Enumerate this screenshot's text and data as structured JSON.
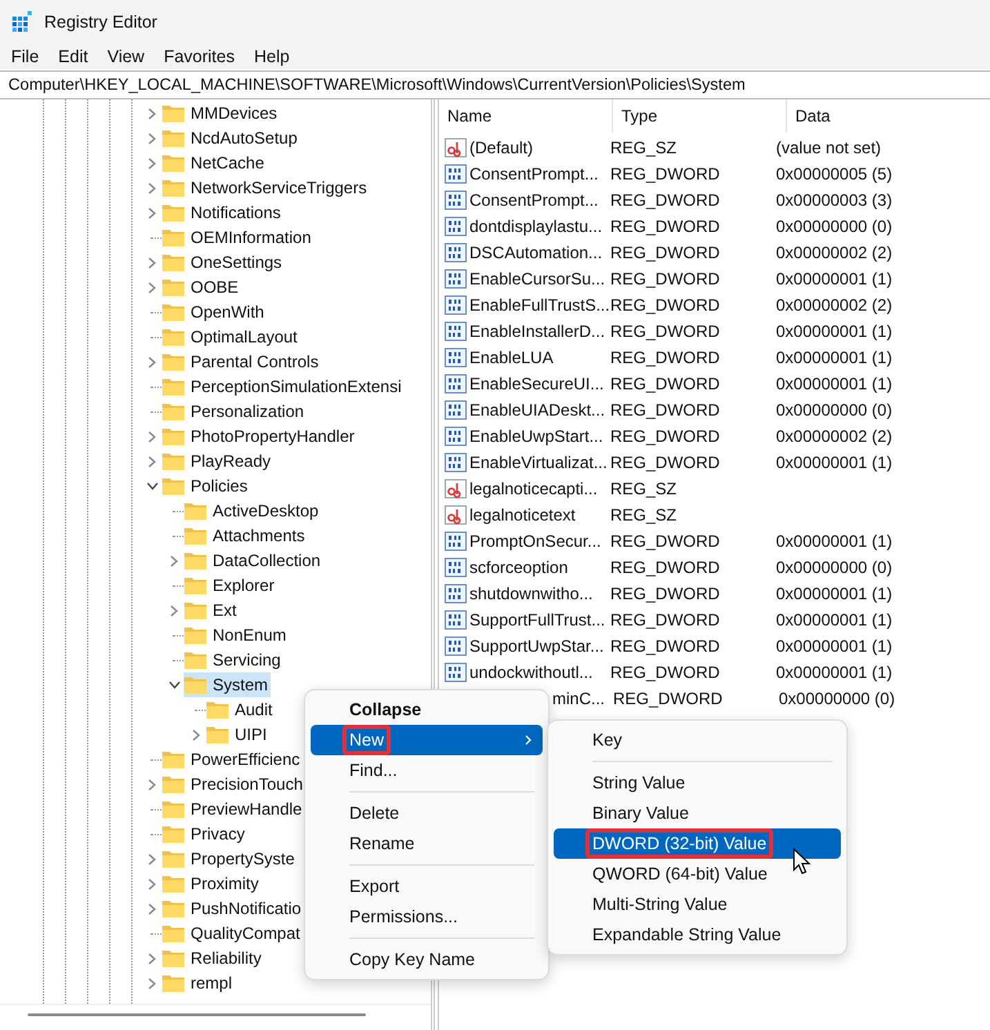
{
  "window": {
    "title": "Registry Editor"
  },
  "menu_bar": [
    "File",
    "Edit",
    "View",
    "Favorites",
    "Help"
  ],
  "address_bar": {
    "value": "Computer\\HKEY_LOCAL_MACHINE\\SOFTWARE\\Microsoft\\Windows\\CurrentVersion\\Policies\\System"
  },
  "tree": [
    {
      "label": "MMDevices",
      "expandable": true,
      "expanded": false,
      "selected": false
    },
    {
      "label": "NcdAutoSetup",
      "expandable": true,
      "expanded": false,
      "selected": false
    },
    {
      "label": "NetCache",
      "expandable": true,
      "expanded": false,
      "selected": false
    },
    {
      "label": "NetworkServiceTriggers",
      "expandable": true,
      "expanded": false,
      "selected": false
    },
    {
      "label": "Notifications",
      "expandable": true,
      "expanded": false,
      "selected": false
    },
    {
      "label": "OEMInformation",
      "expandable": false,
      "selected": false
    },
    {
      "label": "OneSettings",
      "expandable": true,
      "expanded": false,
      "selected": false
    },
    {
      "label": "OOBE",
      "expandable": true,
      "expanded": false,
      "selected": false
    },
    {
      "label": "OpenWith",
      "expandable": false,
      "selected": false
    },
    {
      "label": "OptimalLayout",
      "expandable": false,
      "selected": false
    },
    {
      "label": "Parental Controls",
      "expandable": true,
      "expanded": false,
      "selected": false
    },
    {
      "label": "PerceptionSimulationExtensi",
      "expandable": false,
      "selected": false
    },
    {
      "label": "Personalization",
      "expandable": false,
      "selected": false
    },
    {
      "label": "PhotoPropertyHandler",
      "expandable": true,
      "expanded": false,
      "selected": false
    },
    {
      "label": "PlayReady",
      "expandable": true,
      "expanded": false,
      "selected": false
    },
    {
      "label": "Policies",
      "expandable": true,
      "expanded": true,
      "selected": false,
      "children": [
        {
          "label": "ActiveDesktop",
          "expandable": false,
          "selected": false
        },
        {
          "label": "Attachments",
          "expandable": false,
          "selected": false
        },
        {
          "label": "DataCollection",
          "expandable": true,
          "expanded": false,
          "selected": false
        },
        {
          "label": "Explorer",
          "expandable": false,
          "selected": false
        },
        {
          "label": "Ext",
          "expandable": true,
          "expanded": false,
          "selected": false
        },
        {
          "label": "NonEnum",
          "expandable": false,
          "selected": false
        },
        {
          "label": "Servicing",
          "expandable": false,
          "selected": false
        },
        {
          "label": "System",
          "expandable": true,
          "expanded": true,
          "selected": true,
          "children": [
            {
              "label": "Audit",
              "expandable": false,
              "selected": false
            },
            {
              "label": "UIPI",
              "expandable": true,
              "expanded": false,
              "selected": false
            }
          ]
        }
      ]
    },
    {
      "label": "PowerEfficienc",
      "expandable": false,
      "selected": false
    },
    {
      "label": "PrecisionTouch",
      "expandable": true,
      "expanded": false,
      "selected": false
    },
    {
      "label": "PreviewHandle",
      "expandable": false,
      "selected": false
    },
    {
      "label": "Privacy",
      "expandable": false,
      "selected": false
    },
    {
      "label": "PropertySyste",
      "expandable": true,
      "expanded": false,
      "selected": false
    },
    {
      "label": "Proximity",
      "expandable": true,
      "expanded": false,
      "selected": false
    },
    {
      "label": "PushNotificatio",
      "expandable": true,
      "expanded": false,
      "selected": false
    },
    {
      "label": "QualityCompat",
      "expandable": false,
      "selected": false
    },
    {
      "label": "Reliability",
      "expandable": true,
      "expanded": false,
      "selected": false
    },
    {
      "label": "rempl",
      "expandable": true,
      "expanded": false,
      "selected": false
    }
  ],
  "values": {
    "columns": [
      "Name",
      "Type",
      "Data"
    ],
    "rows": [
      {
        "kind": "string",
        "name": "(Default)",
        "type": "REG_SZ",
        "data": "(value not set)"
      },
      {
        "kind": "dword",
        "name": "ConsentPrompt...",
        "type": "REG_DWORD",
        "data": "0x00000005 (5)"
      },
      {
        "kind": "dword",
        "name": "ConsentPrompt...",
        "type": "REG_DWORD",
        "data": "0x00000003 (3)"
      },
      {
        "kind": "dword",
        "name": "dontdisplaylastu...",
        "type": "REG_DWORD",
        "data": "0x00000000 (0)"
      },
      {
        "kind": "dword",
        "name": "DSCAutomation...",
        "type": "REG_DWORD",
        "data": "0x00000002 (2)"
      },
      {
        "kind": "dword",
        "name": "EnableCursorSu...",
        "type": "REG_DWORD",
        "data": "0x00000001 (1)"
      },
      {
        "kind": "dword",
        "name": "EnableFullTrustS...",
        "type": "REG_DWORD",
        "data": "0x00000002 (2)"
      },
      {
        "kind": "dword",
        "name": "EnableInstallerD...",
        "type": "REG_DWORD",
        "data": "0x00000001 (1)"
      },
      {
        "kind": "dword",
        "name": "EnableLUA",
        "type": "REG_DWORD",
        "data": "0x00000001 (1)"
      },
      {
        "kind": "dword",
        "name": "EnableSecureUI...",
        "type": "REG_DWORD",
        "data": "0x00000001 (1)"
      },
      {
        "kind": "dword",
        "name": "EnableUIADeskt...",
        "type": "REG_DWORD",
        "data": "0x00000000 (0)"
      },
      {
        "kind": "dword",
        "name": "EnableUwpStart...",
        "type": "REG_DWORD",
        "data": "0x00000002 (2)"
      },
      {
        "kind": "dword",
        "name": "EnableVirtualizat...",
        "type": "REG_DWORD",
        "data": "0x00000001 (1)"
      },
      {
        "kind": "string",
        "name": "legalnoticecapti...",
        "type": "REG_SZ"
      },
      {
        "kind": "string",
        "name": "legalnoticetext",
        "type": "REG_SZ"
      },
      {
        "kind": "dword",
        "name": "PromptOnSecur...",
        "type": "REG_DWORD",
        "data": "0x00000001 (1)"
      },
      {
        "kind": "dword",
        "name": "scforceoption",
        "type": "REG_DWORD",
        "data": "0x00000000 (0)"
      },
      {
        "kind": "dword",
        "name": "shutdownwitho...",
        "type": "REG_DWORD",
        "data": "0x00000001 (1)"
      },
      {
        "kind": "dword",
        "name": "SupportFullTrust...",
        "type": "REG_DWORD",
        "data": "0x00000001 (1)"
      },
      {
        "kind": "dword",
        "name": "SupportUwpStar...",
        "type": "REG_DWORD",
        "data": "0x00000001 (1)"
      },
      {
        "kind": "dword",
        "name": "undockwithoutl...",
        "type": "REG_DWORD",
        "data": "0x00000001 (1)"
      },
      {
        "name": "minC...",
        "type": "REG_DWORD",
        "data": "0x00000000 (0)"
      }
    ]
  },
  "context_menu": {
    "items": [
      {
        "kind": "item",
        "label": "Collapse",
        "bold": true,
        "selected": false
      },
      {
        "kind": "item",
        "label": "New",
        "selected": true,
        "outlined": true,
        "submenu": true
      },
      {
        "kind": "item",
        "label": "Find...",
        "selected": false
      },
      {
        "kind": "separator"
      },
      {
        "kind": "item",
        "label": "Delete",
        "selected": false
      },
      {
        "kind": "item",
        "label": "Rename",
        "selected": false
      },
      {
        "kind": "separator"
      },
      {
        "kind": "item",
        "label": "Export",
        "selected": false
      },
      {
        "kind": "item",
        "label": "Permissions...",
        "selected": false
      },
      {
        "kind": "separator"
      },
      {
        "kind": "item",
        "label": "Copy Key Name",
        "selected": false
      }
    ]
  },
  "submenu": {
    "items": [
      {
        "kind": "item",
        "label": "Key",
        "selected": false
      },
      {
        "kind": "separator"
      },
      {
        "kind": "item",
        "label": "String Value",
        "selected": false
      },
      {
        "kind": "item",
        "label": "Binary Value",
        "selected": false
      },
      {
        "kind": "item",
        "label": "DWORD (32-bit) Value",
        "selected": true,
        "outlined": true
      },
      {
        "kind": "item",
        "label": "QWORD (64-bit) Value",
        "selected": false
      },
      {
        "kind": "item",
        "label": "Multi-String Value",
        "selected": false
      },
      {
        "kind": "item",
        "label": "Expandable String Value",
        "selected": false
      }
    ]
  }
}
